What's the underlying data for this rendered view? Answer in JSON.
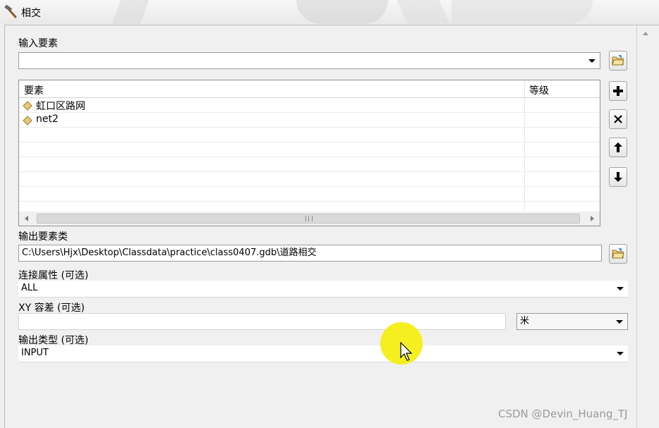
{
  "window": {
    "title": "相交",
    "icon": "hammer-icon"
  },
  "input_features": {
    "label": "输入要素",
    "value": "",
    "list": {
      "columns": [
        "要素",
        "等级"
      ],
      "rows": [
        {
          "name": "虹口区路网",
          "rank": ""
        },
        {
          "name": "net2",
          "rank": ""
        }
      ]
    }
  },
  "toolbar": {
    "browse_icon": "folder-open-icon",
    "add_icon": "plus-icon",
    "remove_icon": "close-icon",
    "up_icon": "arrow-up-icon",
    "down_icon": "arrow-down-icon"
  },
  "output_feature_class": {
    "label": "输出要素类",
    "value": "C:\\Users\\Hjx\\Desktop\\Classdata\\practice\\class0407.gdb\\道路相交"
  },
  "join_attributes": {
    "label": "连接属性 (可选)",
    "value": "ALL"
  },
  "xy_tolerance": {
    "label": "XY 容差 (可选)",
    "value": "",
    "unit": "米"
  },
  "output_type": {
    "label": "输出类型 (可选)",
    "value": "INPUT"
  },
  "watermark": "CSDN @Devin_Huang_TJ",
  "colors": {
    "highlight": "#f4ee13",
    "feature_icon": "#e9c97a"
  }
}
